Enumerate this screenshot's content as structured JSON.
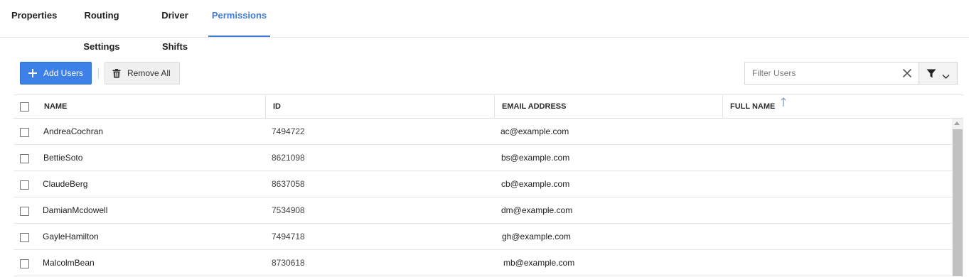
{
  "tabs": [
    {
      "label": "Properties",
      "active": false
    },
    {
      "label": "Routing Settings",
      "active": false
    },
    {
      "label": "Driver Shifts",
      "active": false
    },
    {
      "label": "Permissions",
      "active": true
    }
  ],
  "toolbar": {
    "add_label": "Add Users",
    "remove_label": "Remove All",
    "filter_placeholder": "Filter Users",
    "filter_value": ""
  },
  "grid": {
    "columns": [
      "NAME",
      "ID",
      "EMAIL ADDRESS",
      "FULL NAME"
    ],
    "sorted_column": "FULL NAME",
    "sort_direction": "ascending",
    "rows": [
      {
        "name": "AndreaCochran",
        "id": "7494722",
        "email": "ac@example.com",
        "full_name": ""
      },
      {
        "name": "BettieSoto",
        "id": "8621098",
        "email": "bs@example.com",
        "full_name": ""
      },
      {
        "name": "ClaudeBerg",
        "id": "8637058",
        "email": "cb@example.com",
        "full_name": ""
      },
      {
        "name": "DamianMcdowell",
        "id": "7534908",
        "email": "dm@example.com",
        "full_name": ""
      },
      {
        "name": "GayleHamilton",
        "id": "7494718",
        "email": "gh@example.com",
        "full_name": ""
      },
      {
        "name": "MalcolmBean",
        "id": "8730618",
        "email": "mb@example.com",
        "full_name": ""
      }
    ]
  },
  "colors": {
    "accent": "#3f7ad9",
    "primary_button": "#3d80e8",
    "secondary_button": "#f0f0f0"
  },
  "icons": {
    "add": "plus-icon",
    "remove": "trash-icon",
    "clear": "close-icon",
    "filter": "funnel-icon",
    "dropdown": "chevron-down-icon",
    "sort": "arrow-up-icon"
  }
}
